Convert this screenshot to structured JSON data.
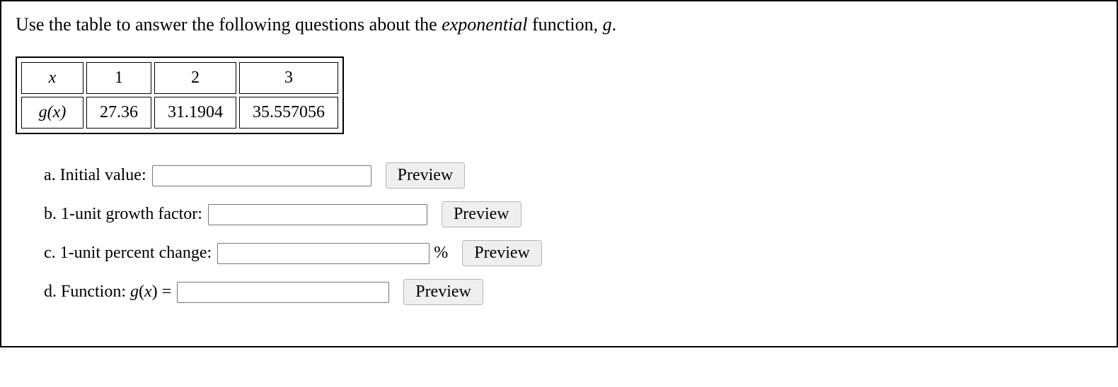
{
  "prompt": {
    "pre": "Use the table to answer the following questions about the ",
    "emph": "exponential",
    "post": " function, ",
    "gvar": "g",
    "period": "."
  },
  "table": {
    "row_x_label": "x",
    "row_gx_label": "g(x)",
    "x": [
      "1",
      "2",
      "3"
    ],
    "gx": [
      "27.36",
      "31.1904",
      "35.557056"
    ]
  },
  "questions": {
    "a_label": "a. Initial value:",
    "b_label": "b. 1-unit growth factor:",
    "c_label": "c. 1-unit percent change:",
    "c_suffix": "%",
    "d_label_pre": "d. Function: ",
    "d_label_g": "g",
    "d_label_paren_open": "(",
    "d_label_x": "x",
    "d_label_paren_close": ")",
    "d_label_eq": " = "
  },
  "buttons": {
    "preview": "Preview"
  },
  "chart_data": {
    "type": "table",
    "columns_header": "x",
    "rows_header": "g(x)",
    "x": [
      1,
      2,
      3
    ],
    "gx": [
      27.36,
      31.1904,
      35.557056
    ]
  }
}
